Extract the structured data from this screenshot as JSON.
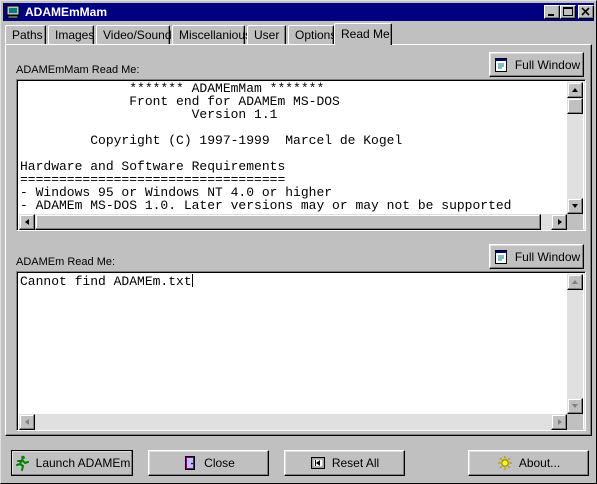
{
  "window": {
    "title": "ADAMEmMam",
    "icon": "computer-icon",
    "titlebar_color": "#000080",
    "face_color": "#c0c0c0"
  },
  "tabs": [
    {
      "label": "Paths"
    },
    {
      "label": "Images"
    },
    {
      "label": "Video/Sound"
    },
    {
      "label": "Miscellanious"
    },
    {
      "label": "User"
    },
    {
      "label": "Options"
    },
    {
      "label": "Read Me"
    }
  ],
  "active_tab": "Read Me",
  "readme_mam": {
    "label": "ADAMEmMam Read Me:",
    "full_window_label": "Full Window",
    "full_window_icon": "window-icon",
    "lines": [
      "              ******* ADAMEmMam *******",
      "              Front end for ADAMEm MS-DOS",
      "                      Version 1.1",
      "",
      "         Copyright (C) 1997-1999  Marcel de Kogel",
      "",
      "Hardware and Software Requirements",
      "==================================",
      "- Windows 95 or Windows NT 4.0 or higher",
      "- ADAMEm MS-DOS 1.0. Later versions may or may not be supported"
    ]
  },
  "readme_adamem": {
    "label": "ADAMEm Read Me:",
    "full_window_label": "Full Window",
    "full_window_icon": "window-icon",
    "lines": [
      "Cannot find ADAMEm.txt"
    ]
  },
  "buttons": {
    "launch": {
      "label": "Launch ADAMEm",
      "icon": "running-man-icon"
    },
    "close": {
      "label": "Close",
      "icon": "door-icon"
    },
    "reset": {
      "label": "Reset All",
      "icon": "rewind-icon"
    },
    "about": {
      "label": "About...",
      "icon": "sun-icon"
    }
  }
}
